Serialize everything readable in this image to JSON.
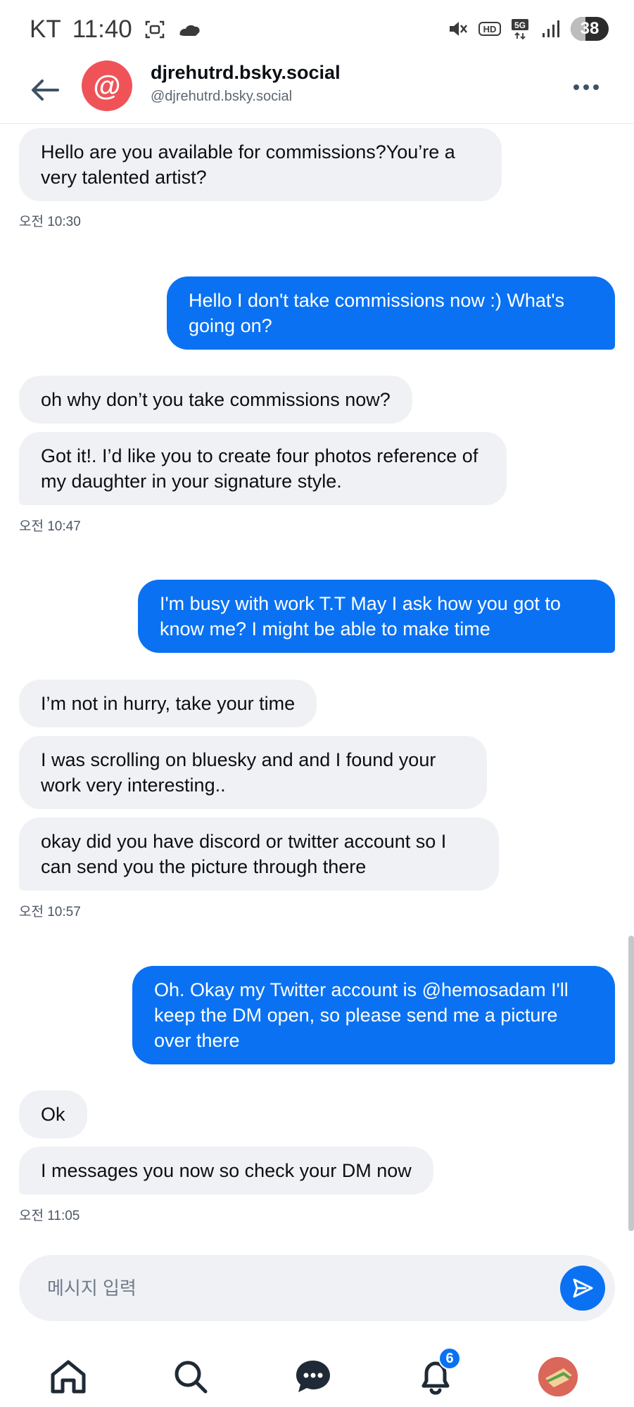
{
  "status_bar": {
    "carrier": "KT",
    "time": "11:40",
    "battery_level": "38",
    "battery_fraction": 0.38,
    "icons": [
      "screenshot-icon",
      "cloud-icon",
      "mute-icon",
      "hd-icon",
      "5g-icon",
      "signal-icon"
    ],
    "hd_label": "HD",
    "network_label": "5G"
  },
  "header": {
    "display_name": "djrehutrd.bsky.social",
    "handle": "@djrehutrd.bsky.social",
    "avatar_symbol": "@",
    "avatar_color": "#ef5358"
  },
  "messages": [
    {
      "from": "them",
      "text": "Hello are you available for commissions?You’re a very talented artist?"
    },
    {
      "time": "오전 10:30"
    },
    {
      "from": "me",
      "text": "Hello I don't take commissions now :) What's going on?"
    },
    {
      "from": "them",
      "text": "oh why don’t you take commissions now?"
    },
    {
      "from": "them",
      "text": "Got it!. I’d like you to create four photos reference of my daughter in your signature style."
    },
    {
      "time": "오전 10:47"
    },
    {
      "from": "me",
      "text": "I'm busy with work T.T May I ask how you got to know me? I might be able to make time"
    },
    {
      "from": "them",
      "text": "I’m not in hurry, take your time"
    },
    {
      "from": "them",
      "text": "I was scrolling on bluesky and and I found your work very interesting.."
    },
    {
      "from": "them",
      "text": "okay did you have discord or twitter account so I can send you the picture through there"
    },
    {
      "time": "오전 10:57"
    },
    {
      "from": "me",
      "text": "Oh. Okay my Twitter account is @hemosadam I'll keep the DM open, so please send me a picture over there"
    },
    {
      "from": "them",
      "text": "Ok"
    },
    {
      "from": "them",
      "text": "I messages you now so check your DM now"
    },
    {
      "time": "오전 11:05"
    }
  ],
  "composer": {
    "placeholder": "메시지 입력"
  },
  "bottom_nav": {
    "items": [
      "home-icon",
      "search-icon",
      "chat-icon",
      "bell-icon",
      "profile-avatar"
    ],
    "notification_count": "6"
  },
  "colors": {
    "accent": "#0a72f2",
    "incoming_bubble": "#eff1f5",
    "outgoing_text": "#ffffff"
  }
}
